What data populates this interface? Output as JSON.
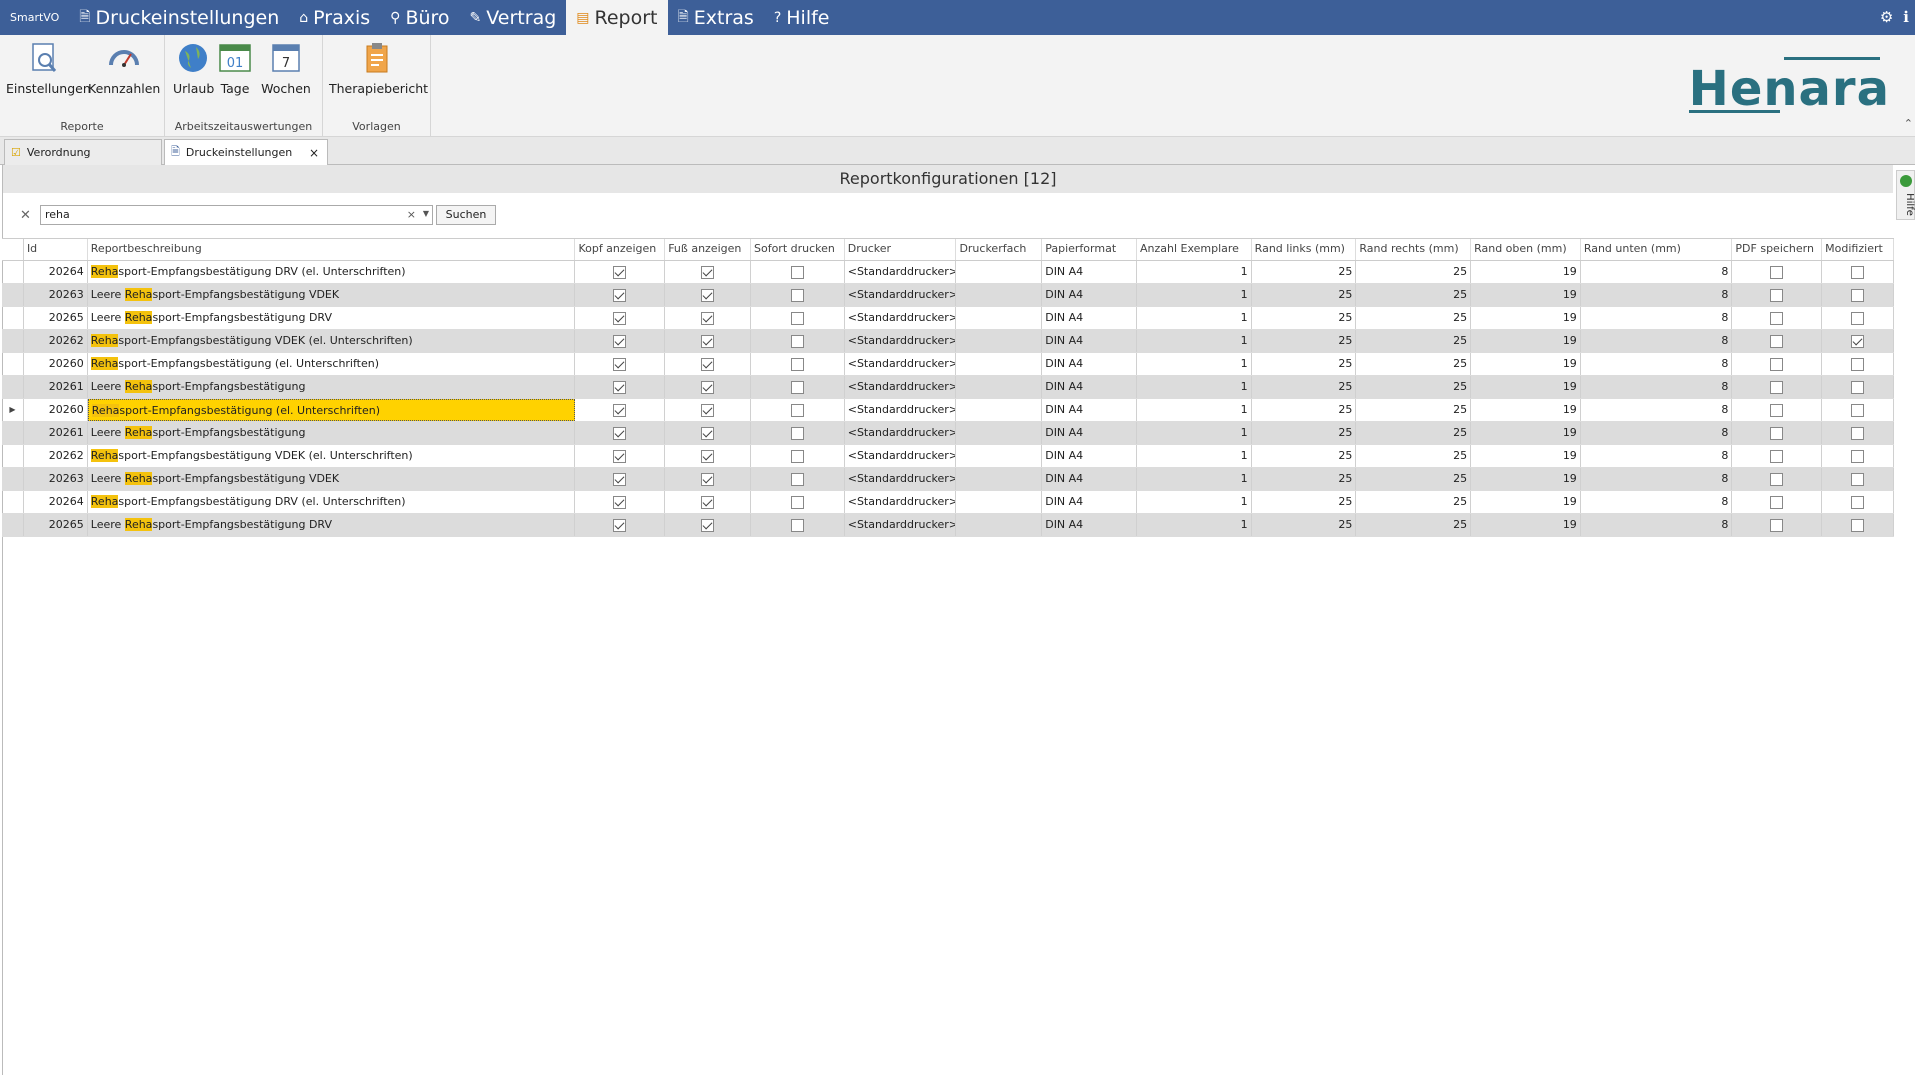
{
  "app": {
    "brand": "SmartVO"
  },
  "menu": [
    {
      "label": "Druckeinstellungen",
      "icon": "print-settings-icon"
    },
    {
      "label": "Praxis",
      "icon": "home-icon"
    },
    {
      "label": "Büro",
      "icon": "link-icon"
    },
    {
      "label": "Vertrag",
      "icon": "contract-icon"
    },
    {
      "label": "Report",
      "icon": "clipboard-icon"
    },
    {
      "label": "Extras",
      "icon": "extras-icon"
    },
    {
      "label": "Hilfe",
      "icon": "help-icon"
    }
  ],
  "ribbon": {
    "groups": [
      {
        "label": "Reporte",
        "buttons": [
          "Einstellungen",
          "Kennzahlen"
        ]
      },
      {
        "label": "Arbeitszeitauswertungen",
        "buttons": [
          "Urlaub",
          "Tage",
          "Wochen"
        ]
      },
      {
        "label": "Vorlagen",
        "buttons": [
          "Therapiebericht"
        ]
      }
    ],
    "tage_icon_text": "01",
    "wochen_icon_text": "7"
  },
  "logo": "Henara",
  "tabs": [
    {
      "label": "Verordnung"
    },
    {
      "label": "Druckeinstellungen"
    }
  ],
  "panel": {
    "title": "Reportkonfigurationen [12]",
    "side_help": "Hilfe"
  },
  "search": {
    "value": "reha",
    "button": "Suchen"
  },
  "columns": [
    "Id",
    "Reportbeschreibung",
    "Kopf anzeigen",
    "Fuß anzeigen",
    "Sofort drucken",
    "Drucker",
    "Druckerfach",
    "Papierformat",
    "Anzahl Exemplare",
    "Rand links (mm)",
    "Rand rechts (mm)",
    "Rand oben (mm)",
    "Rand unten (mm)",
    "PDF speichern",
    "Modifiziert"
  ],
  "rows": [
    {
      "id": "20264",
      "pre": "",
      "hl": "Reha",
      "post": "sport-Empfangsbestätigung DRV (el. Unterschriften)",
      "kopf": true,
      "fuss": true,
      "sofort": false,
      "drucker": "<Standarddrucker>",
      "fach": "",
      "format": "DIN A4",
      "anz": "1",
      "rl": "25",
      "rr": "25",
      "ro": "19",
      "ru": "8",
      "pdf": false,
      "mod": false
    },
    {
      "id": "20263",
      "pre": "Leere ",
      "hl": "Reha",
      "post": "sport-Empfangsbestätigung VDEK",
      "kopf": true,
      "fuss": true,
      "sofort": false,
      "drucker": "<Standarddrucker>",
      "fach": "",
      "format": "DIN A4",
      "anz": "1",
      "rl": "25",
      "rr": "25",
      "ro": "19",
      "ru": "8",
      "pdf": false,
      "mod": false
    },
    {
      "id": "20265",
      "pre": "Leere ",
      "hl": "Reha",
      "post": "sport-Empfangsbestätigung DRV",
      "kopf": true,
      "fuss": true,
      "sofort": false,
      "drucker": "<Standarddrucker>",
      "fach": "",
      "format": "DIN A4",
      "anz": "1",
      "rl": "25",
      "rr": "25",
      "ro": "19",
      "ru": "8",
      "pdf": false,
      "mod": false
    },
    {
      "id": "20262",
      "pre": "",
      "hl": "Reha",
      "post": "sport-Empfangsbestätigung VDEK (el. Unterschriften)",
      "kopf": true,
      "fuss": true,
      "sofort": false,
      "drucker": "<Standarddrucker>",
      "fach": "",
      "format": "DIN A4",
      "anz": "1",
      "rl": "25",
      "rr": "25",
      "ro": "19",
      "ru": "8",
      "pdf": false,
      "mod": true
    },
    {
      "id": "20260",
      "pre": "",
      "hl": "Reha",
      "post": "sport-Empfangsbestätigung (el. Unterschriften)",
      "kopf": true,
      "fuss": true,
      "sofort": false,
      "drucker": "<Standarddrucker>",
      "fach": "",
      "format": "DIN A4",
      "anz": "1",
      "rl": "25",
      "rr": "25",
      "ro": "19",
      "ru": "8",
      "pdf": false,
      "mod": false
    },
    {
      "id": "20261",
      "pre": "Leere ",
      "hl": "Reha",
      "post": "sport-Empfangsbestätigung",
      "kopf": true,
      "fuss": true,
      "sofort": false,
      "drucker": "<Standarddrucker>",
      "fach": "",
      "format": "DIN A4",
      "anz": "1",
      "rl": "25",
      "rr": "25",
      "ro": "19",
      "ru": "8",
      "pdf": false,
      "mod": false
    },
    {
      "id": "20260",
      "pre": "",
      "hl": "Reha",
      "post": "sport-Empfangsbestätigung (el. Unterschriften)",
      "kopf": true,
      "fuss": true,
      "sofort": false,
      "drucker": "<Standarddrucker>",
      "fach": "",
      "format": "DIN A4",
      "anz": "1",
      "rl": "25",
      "rr": "25",
      "ro": "19",
      "ru": "8",
      "pdf": false,
      "mod": false,
      "selected": true
    },
    {
      "id": "20261",
      "pre": "Leere ",
      "hl": "Reha",
      "post": "sport-Empfangsbestätigung",
      "kopf": true,
      "fuss": true,
      "sofort": false,
      "drucker": "<Standarddrucker>",
      "fach": "",
      "format": "DIN A4",
      "anz": "1",
      "rl": "25",
      "rr": "25",
      "ro": "19",
      "ru": "8",
      "pdf": false,
      "mod": false
    },
    {
      "id": "20262",
      "pre": "",
      "hl": "Reha",
      "post": "sport-Empfangsbestätigung VDEK (el. Unterschriften)",
      "kopf": true,
      "fuss": true,
      "sofort": false,
      "drucker": "<Standarddrucker>",
      "fach": "",
      "format": "DIN A4",
      "anz": "1",
      "rl": "25",
      "rr": "25",
      "ro": "19",
      "ru": "8",
      "pdf": false,
      "mod": false
    },
    {
      "id": "20263",
      "pre": "Leere ",
      "hl": "Reha",
      "post": "sport-Empfangsbestätigung VDEK",
      "kopf": true,
      "fuss": true,
      "sofort": false,
      "drucker": "<Standarddrucker>",
      "fach": "",
      "format": "DIN A4",
      "anz": "1",
      "rl": "25",
      "rr": "25",
      "ro": "19",
      "ru": "8",
      "pdf": false,
      "mod": false
    },
    {
      "id": "20264",
      "pre": "",
      "hl": "Reha",
      "post": "sport-Empfangsbestätigung DRV (el. Unterschriften)",
      "kopf": true,
      "fuss": true,
      "sofort": false,
      "drucker": "<Standarddrucker>",
      "fach": "",
      "format": "DIN A4",
      "anz": "1",
      "rl": "25",
      "rr": "25",
      "ro": "19",
      "ru": "8",
      "pdf": false,
      "mod": false
    },
    {
      "id": "20265",
      "pre": "Leere ",
      "hl": "Reha",
      "post": "sport-Empfangsbestätigung DRV",
      "kopf": true,
      "fuss": true,
      "sofort": false,
      "drucker": "<Standarddrucker>",
      "fach": "",
      "format": "DIN A4",
      "anz": "1",
      "rl": "25",
      "rr": "25",
      "ro": "19",
      "ru": "8",
      "pdf": false,
      "mod": false
    }
  ],
  "colors": {
    "menubar": "#3d5f98",
    "highlight": "#f4c20d",
    "selection": "#ffd200",
    "logo": "#2a7080"
  }
}
